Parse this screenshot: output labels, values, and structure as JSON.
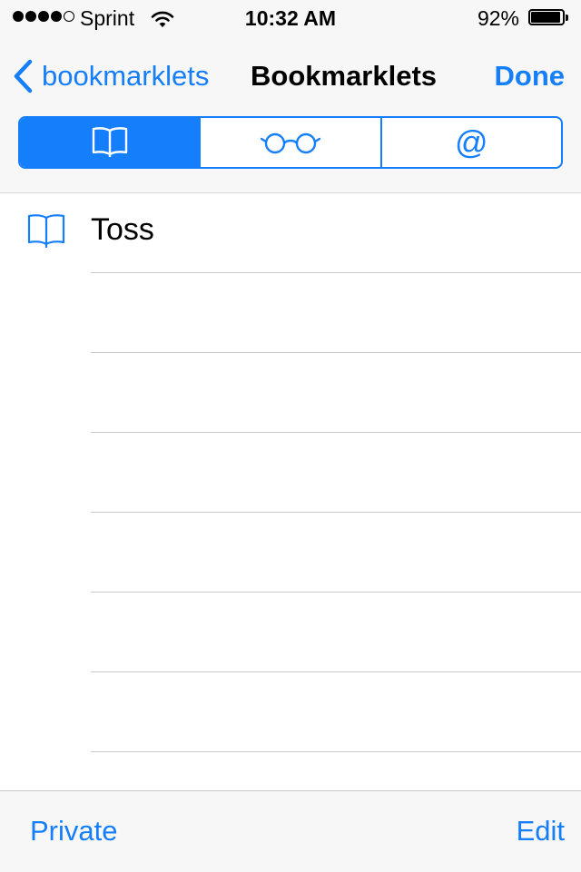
{
  "status_bar": {
    "carrier": "Sprint",
    "time": "10:32 AM",
    "battery_percent": "92%",
    "signal_bars_filled": 4,
    "signal_bars_total": 5
  },
  "nav": {
    "back_label": "bookmarklets",
    "title": "Bookmarklets",
    "done_label": "Done"
  },
  "segments": [
    {
      "icon": "book-icon",
      "selected": true
    },
    {
      "icon": "reading-glasses-icon",
      "selected": false
    },
    {
      "icon": "at-sign-icon",
      "selected": false
    }
  ],
  "segment_at_glyph": "@",
  "list": {
    "items": [
      {
        "title": "Toss",
        "icon": "book-icon"
      }
    ],
    "empty_rows": 6
  },
  "toolbar": {
    "left_label": "Private",
    "right_label": "Edit"
  },
  "colors": {
    "accent": "#147efb",
    "bar_background": "#f7f7f7",
    "separator": "#c8c7cc"
  }
}
